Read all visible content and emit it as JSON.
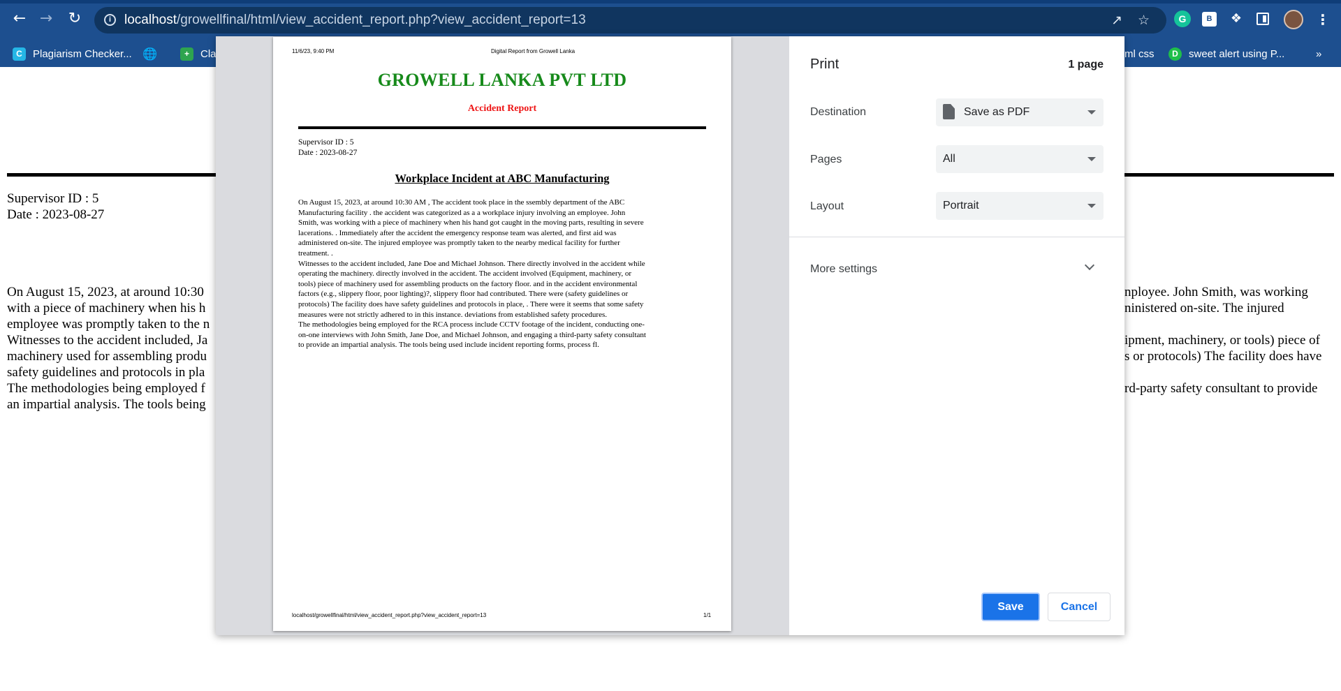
{
  "browser": {
    "url_host": "localhost",
    "url_path": "/growellfinal/html/view_accident_report.php?view_accident_report=13",
    "bookmarks": [
      "Plagiarism Checker...",
      "Cla",
      "ml css",
      "sweet alert using P...",
      "»"
    ]
  },
  "background_page": {
    "supervisor_id": "Supervisor ID : 5",
    "date": "Date : 2023-08-27",
    "left_lines": [
      "On August 15, 2023, at around 10:30",
      "with a piece of machinery when his h",
      "employee was promptly taken to the n",
      "Witnesses to the accident included, Ja",
      "machinery used for assembling produ",
      "safety guidelines and protocols in pla",
      "The methodologies being employed f",
      "an impartial analysis. The tools being"
    ],
    "right_lines": [
      "nployee. John Smith, was working",
      "ninistered on-site. The injured",
      "",
      "ipment, machinery, or tools) piece of",
      "s or protocols) The facility does have",
      "",
      "rd-party safety consultant to provide"
    ]
  },
  "preview": {
    "header_left": "11/6/23, 9:40 PM",
    "header_center": "Digital Report from Growell Lanka",
    "company": "GROWELL LANKA PVT LTD",
    "subtitle": "Accident Report",
    "supervisor_id": "Supervisor ID : 5",
    "date": "Date : 2023-08-27",
    "report_title": "Workplace Incident at ABC Manufacturing",
    "body_lines": [
      "On August 15, 2023, at around 10:30 AM , The accident took place in the ssembly department of the ABC",
      "Manufacturing facility . the accident was categorized as a a workplace injury involving an employee. John",
      "Smith, was working with a piece of machinery when his hand got caught in the moving parts, resulting in severe",
      "lacerations. . Immediately after the accident the emergency response team was alerted, and first aid was",
      "administered on-site. The injured employee was promptly taken to the nearby medical facility for further",
      "treatment. .",
      "Witnesses to the accident included, Jane Doe and Michael Johnson. There directly involved in the accident while",
      "operating the machinery. directly involved in the accident. The accident involved (Equipment, machinery, or",
      "tools) piece of machinery used for assembling products on the factory floor. and in the accident environmental",
      "factors (e.g., slippery floor, poor lighting)?, slippery floor had contributed. There were (safety guidelines or",
      "protocols) The facility does have safety guidelines and protocols in place, . There were it seems that some safety",
      "measures were not strictly adhered to in this instance. deviations from established safety procedures.",
      "The methodologies being employed for the RCA process include CCTV footage of the incident, conducting one-",
      "on-one interviews with John Smith, Jane Doe, and Michael Johnson, and engaging a third-party safety consultant",
      "to provide an impartial analysis. The tools being used include incident reporting forms, process fl."
    ],
    "footer_left": "localhost/growellfinal/html/view_accident_report.php?view_accident_report=13",
    "footer_right": "1/1"
  },
  "print_settings": {
    "title": "Print",
    "page_count": "1 page",
    "destination_label": "Destination",
    "destination_value": "Save as PDF",
    "pages_label": "Pages",
    "pages_value": "All",
    "layout_label": "Layout",
    "layout_value": "Portrait",
    "more_settings": "More settings",
    "save_label": "Save",
    "cancel_label": "Cancel"
  },
  "colors": {
    "chrome": "#1d4f8f",
    "company_green": "#178a1b",
    "subtitle_red": "#ee1414",
    "primary_button": "#1a73e8"
  }
}
